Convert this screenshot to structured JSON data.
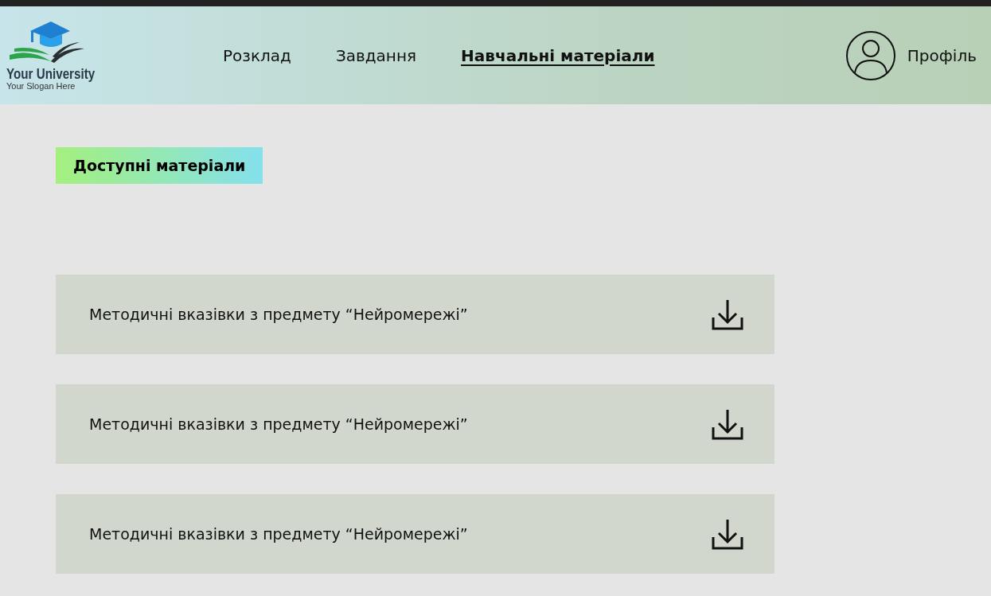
{
  "logo": {
    "name": "Your University",
    "slogan": "Your Slogan Here"
  },
  "nav": [
    {
      "label": "Розклад",
      "selected": false
    },
    {
      "label": "Завдання",
      "selected": false
    },
    {
      "label": "Навчальні матеріали",
      "selected": true
    }
  ],
  "profile": {
    "label": "Профіль"
  },
  "section_title": "Доступні матеріали",
  "materials": [
    {
      "title": "Методичні вказівки з предмету “Нейромережі”"
    },
    {
      "title": "Методичні вказівки з предмету “Нейромережі”"
    },
    {
      "title": "Методичні вказівки з предмету “Нейромережі”"
    }
  ]
}
